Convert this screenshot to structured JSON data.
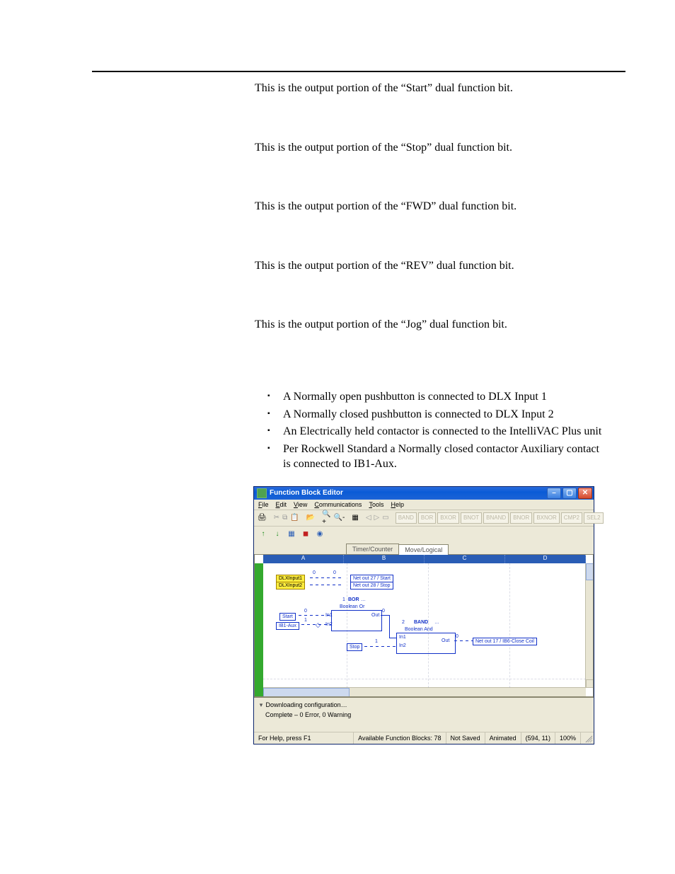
{
  "doc": {
    "p_start": "This is the output portion of the “Start” dual function bit.",
    "p_stop": "This is the output portion of the “Stop” dual function bit.",
    "p_fwd": "This is the output portion of the “FWD” dual function bit.",
    "p_rev": "This is the output portion of the “REV” dual function bit.",
    "p_jog": "This is the output portion of the “Jog” dual function bit.",
    "bullets": [
      "A Normally open pushbutton is connected to DLX Input 1",
      "A Normally closed pushbutton is connected to DLX Input 2",
      "An Electrically held contactor is connected to the IntelliVAC Plus unit",
      "Per Rockwell Standard a Normally closed contactor Auxiliary contact is connected to IB1-Aux."
    ]
  },
  "app": {
    "title": "Function Block Editor",
    "menu": {
      "file": "File",
      "edit": "Edit",
      "view": "View",
      "comm": "Communications",
      "tools": "Tools",
      "help": "Help"
    },
    "tabs": {
      "timer": "Timer/Counter",
      "move": "Move/Logical"
    },
    "tb2": {
      "btns": [
        "BAND",
        "BOR",
        "BXOR",
        "BNOT",
        "BNAND",
        "BNOR",
        "BXNOR",
        "CMP2",
        "SEL2"
      ]
    },
    "columns": {
      "a": "A",
      "b": "B",
      "c": "C",
      "d": "D"
    },
    "diagram": {
      "dlx1": "DLXInput1",
      "dlx2": "DLXInput2",
      "net27": "Net out 27 / Start",
      "net28": "Net out 28 / Stop",
      "start": "Start",
      "ib1": "IB1-Aux",
      "stop": "Stop",
      "bor_t": "BOR",
      "bor_s": "Boolean Or",
      "band_t": "BAND",
      "band_s": "Boolean And",
      "out": "Out",
      "in1": "In1",
      "in2": "In2",
      "one": "1",
      "two": "2",
      "zero": "0",
      "net17": "Net out 17 / IB6-Close Coil"
    },
    "output": {
      "line1": "Downloading configuration…",
      "line2": "Complete – 0 Error, 0 Warning"
    },
    "status": {
      "help": "For Help, press F1",
      "blocks": "Available Function Blocks: 78",
      "saved": "Not Saved",
      "anim": "Animated",
      "coord": "(594, 11)",
      "zoom": "100%"
    }
  }
}
